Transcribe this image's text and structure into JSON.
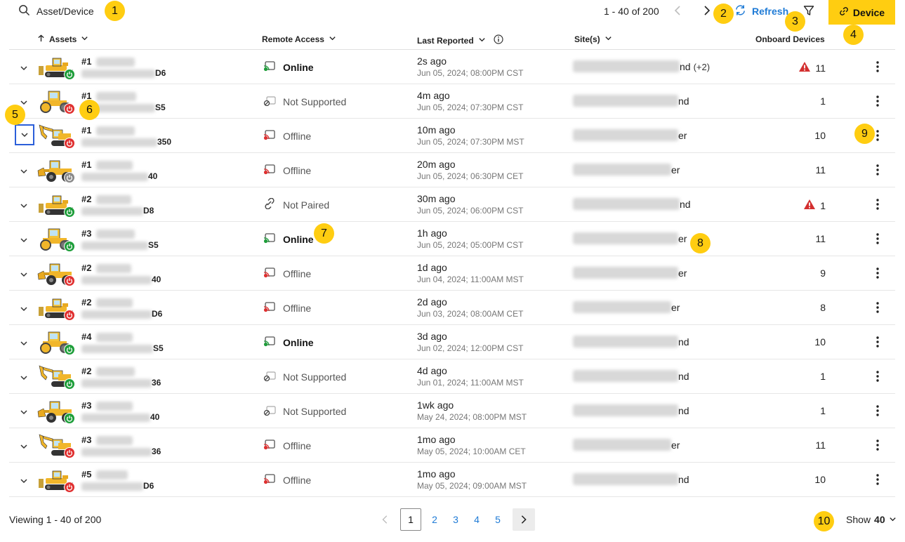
{
  "search": {
    "placeholder": "Asset/Device"
  },
  "toolbar": {
    "range_text": "1 - 40 of 200",
    "refresh_label": "Refresh",
    "device_label": "Device"
  },
  "table": {
    "headers": {
      "assets": "Assets",
      "remote_access": "Remote Access",
      "last_reported": "Last Reported",
      "sites": "Site(s)",
      "onboard": "Onboard Devices"
    },
    "rows": [
      {
        "prefix": "#1",
        "model_suffix": "D6",
        "machine": "dozer",
        "power": "on",
        "access": "Online",
        "rel": "2s ago",
        "abs": "Jun 05, 2024; 08:00PM CST",
        "site_suffix": "nd",
        "site_extra": "(+2)",
        "onboard": "11",
        "warning": true
      },
      {
        "prefix": "#1",
        "model_suffix": "S5",
        "machine": "roller",
        "power": "off",
        "access": "Not Supported",
        "rel": "4m ago",
        "abs": "Jun 05, 2024; 07:30PM CST",
        "site_suffix": "nd",
        "site_extra": "",
        "onboard": "1",
        "warning": false
      },
      {
        "prefix": "#1",
        "model_suffix": "350",
        "machine": "excavator",
        "power": "off",
        "access": "Offline",
        "rel": "10m ago",
        "abs": "Jun 05, 2024; 07:30PM MST",
        "site_suffix": "er",
        "site_extra": "",
        "onboard": "10",
        "warning": false
      },
      {
        "prefix": "#1",
        "model_suffix": "40",
        "machine": "loader",
        "power": "idle",
        "access": "Offline",
        "rel": "20m ago",
        "abs": "Jun 05, 2024; 06:30PM CET",
        "site_suffix": "er",
        "site_extra": "",
        "onboard": "11",
        "warning": false
      },
      {
        "prefix": "#2",
        "model_suffix": "D8",
        "machine": "dozer",
        "power": "on",
        "access": "Not Paired",
        "rel": "30m ago",
        "abs": "Jun 05, 2024; 06:00PM CST",
        "site_suffix": "nd",
        "site_extra": "",
        "onboard": "1",
        "warning": true
      },
      {
        "prefix": "#3",
        "model_suffix": "S5",
        "machine": "roller",
        "power": "on",
        "access": "Online",
        "rel": "1h ago",
        "abs": "Jun 05, 2024; 05:00PM CST",
        "site_suffix": "er",
        "site_extra": "",
        "onboard": "11",
        "warning": false
      },
      {
        "prefix": "#2",
        "model_suffix": "40",
        "machine": "loader",
        "power": "off",
        "access": "Offline",
        "rel": "1d ago",
        "abs": "Jun 04, 2024; 11:00AM MST",
        "site_suffix": "er",
        "site_extra": "",
        "onboard": "9",
        "warning": false
      },
      {
        "prefix": "#2",
        "model_suffix": "D6",
        "machine": "dozer",
        "power": "off",
        "access": "Offline",
        "rel": "2d ago",
        "abs": "Jun 03, 2024; 08:00AM CET",
        "site_suffix": "er",
        "site_extra": "",
        "onboard": "8",
        "warning": false
      },
      {
        "prefix": "#4",
        "model_suffix": "S5",
        "machine": "roller",
        "power": "on",
        "access": "Online",
        "rel": "3d ago",
        "abs": "Jun 02, 2024; 12:00PM CST",
        "site_suffix": "nd",
        "site_extra": "",
        "onboard": "10",
        "warning": false
      },
      {
        "prefix": "#2",
        "model_suffix": "36",
        "machine": "excavator",
        "power": "on",
        "access": "Not Supported",
        "rel": "4d ago",
        "abs": "Jun 01, 2024; 11:00AM MST",
        "site_suffix": "nd",
        "site_extra": "",
        "onboard": "1",
        "warning": false
      },
      {
        "prefix": "#3",
        "model_suffix": "40",
        "machine": "loader",
        "power": "on",
        "access": "Not Supported",
        "rel": "1wk ago",
        "abs": "May 24, 2024; 08:00PM MST",
        "site_suffix": "nd",
        "site_extra": "",
        "onboard": "1",
        "warning": false
      },
      {
        "prefix": "#3",
        "model_suffix": "36",
        "machine": "excavator",
        "power": "off",
        "access": "Offline",
        "rel": "1mo ago",
        "abs": "May 05, 2024; 10:00AM CET",
        "site_suffix": "er",
        "site_extra": "",
        "onboard": "11",
        "warning": false
      },
      {
        "prefix": "#5",
        "model_suffix": "D6",
        "machine": "dozer",
        "power": "off",
        "access": "Offline",
        "rel": "1mo ago",
        "abs": "May 05, 2024; 09:00AM MST",
        "site_suffix": "nd",
        "site_extra": "",
        "onboard": "10",
        "warning": false
      }
    ]
  },
  "footer": {
    "viewing_text": "Viewing 1 - 40 of 200",
    "pages": [
      "1",
      "2",
      "3",
      "4",
      "5"
    ],
    "current_page": "1",
    "show_label": "Show",
    "show_value": "40"
  },
  "callouts": [
    "1",
    "2",
    "3",
    "4",
    "5",
    "6",
    "7",
    "8",
    "9",
    "10"
  ],
  "colors": {
    "brand_yellow": "#ffcd11",
    "link_blue": "#1f7bd6",
    "online_green": "#1e9e3a",
    "offline_red": "#e03030",
    "idle_gray": "#8a8a8a",
    "warning_red": "#d32f2f",
    "focus_blue": "#2b5fd9"
  }
}
